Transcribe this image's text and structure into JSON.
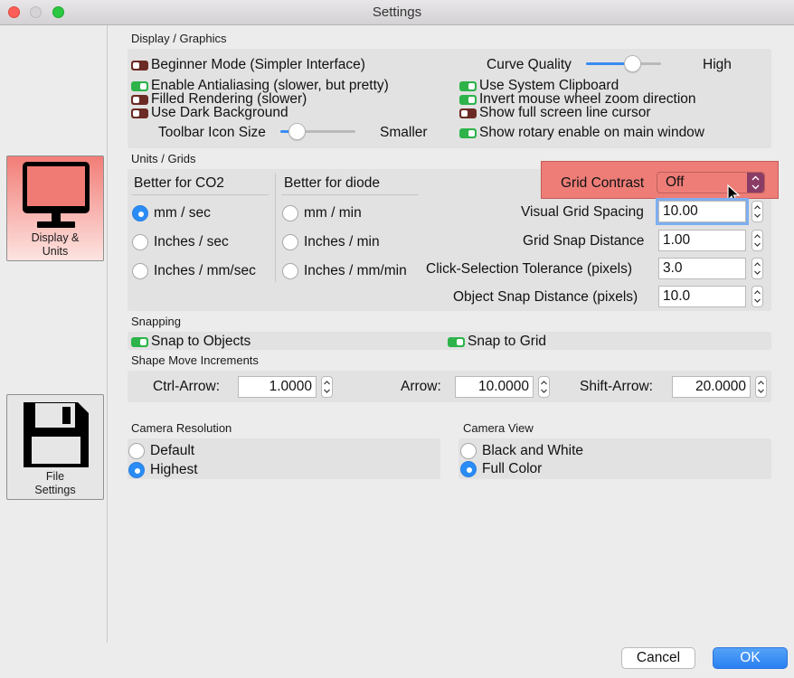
{
  "window": {
    "title": "Settings"
  },
  "sidebar": {
    "items": [
      {
        "label": "Display &\nUnits",
        "active": true
      },
      {
        "label": "File\nSettings",
        "active": false
      }
    ]
  },
  "display": {
    "section_title": "Display / Graphics",
    "beginner_mode": "Beginner Mode (Simpler Interface)",
    "curve_quality_label": "Curve Quality",
    "curve_quality_high": "High",
    "curve_quality_value": 0.6,
    "antialiasing": "Enable Antialiasing (slower, but pretty)",
    "filled_rendering": "Filled Rendering (slower)",
    "dark_background": "Use Dark Background",
    "toolbar_icon_size": "Toolbar Icon Size",
    "toolbar_smaller": "Smaller",
    "toolbar_icon_value": 0.2,
    "system_clipboard": "Use System Clipboard",
    "invert_wheel": "Invert mouse wheel zoom direction",
    "full_screen_cursor": "Show full screen line cursor",
    "show_rotary": "Show rotary enable on main window"
  },
  "units": {
    "section_title": "Units / Grids",
    "co2_header": "Better for CO2",
    "diode_header": "Better for diode",
    "co2_options": [
      "mm / sec",
      "Inches / sec",
      "Inches / mm/sec"
    ],
    "diode_options": [
      "mm / min",
      "Inches / min",
      "Inches / mm/min"
    ],
    "grid_contrast_label": "Grid Contrast",
    "grid_contrast_value": "Off",
    "visual_grid_spacing_label": "Visual Grid Spacing",
    "visual_grid_spacing_value": "10.00",
    "grid_snap_label": "Grid Snap Distance",
    "grid_snap_value": "1.00",
    "click_tolerance_label": "Click-Selection Tolerance (pixels)",
    "click_tolerance_value": "3.0",
    "object_snap_label": "Object Snap Distance (pixels)",
    "object_snap_value": "10.0"
  },
  "snapping": {
    "section_title": "Snapping",
    "snap_objects": "Snap to Objects",
    "snap_grid": "Snap to Grid"
  },
  "shape_move": {
    "section_title": "Shape Move Increments",
    "ctrl_arrow_label": "Ctrl-Arrow:",
    "ctrl_arrow_value": "1.0000",
    "arrow_label": "Arrow:",
    "arrow_value": "10.0000",
    "shift_arrow_label": "Shift-Arrow:",
    "shift_arrow_value": "20.0000"
  },
  "camera_resolution": {
    "section_title": "Camera Resolution",
    "options": [
      "Default",
      "Highest"
    ]
  },
  "camera_view": {
    "section_title": "Camera View",
    "options": [
      "Black and White",
      "Full Color"
    ]
  },
  "footer": {
    "cancel": "Cancel",
    "ok": "OK"
  },
  "colors": {
    "accent": "#2a80f2",
    "highlight": "#ee7d78",
    "toggle_on": "#2db34a",
    "toggle_off": "#6b2a24"
  }
}
